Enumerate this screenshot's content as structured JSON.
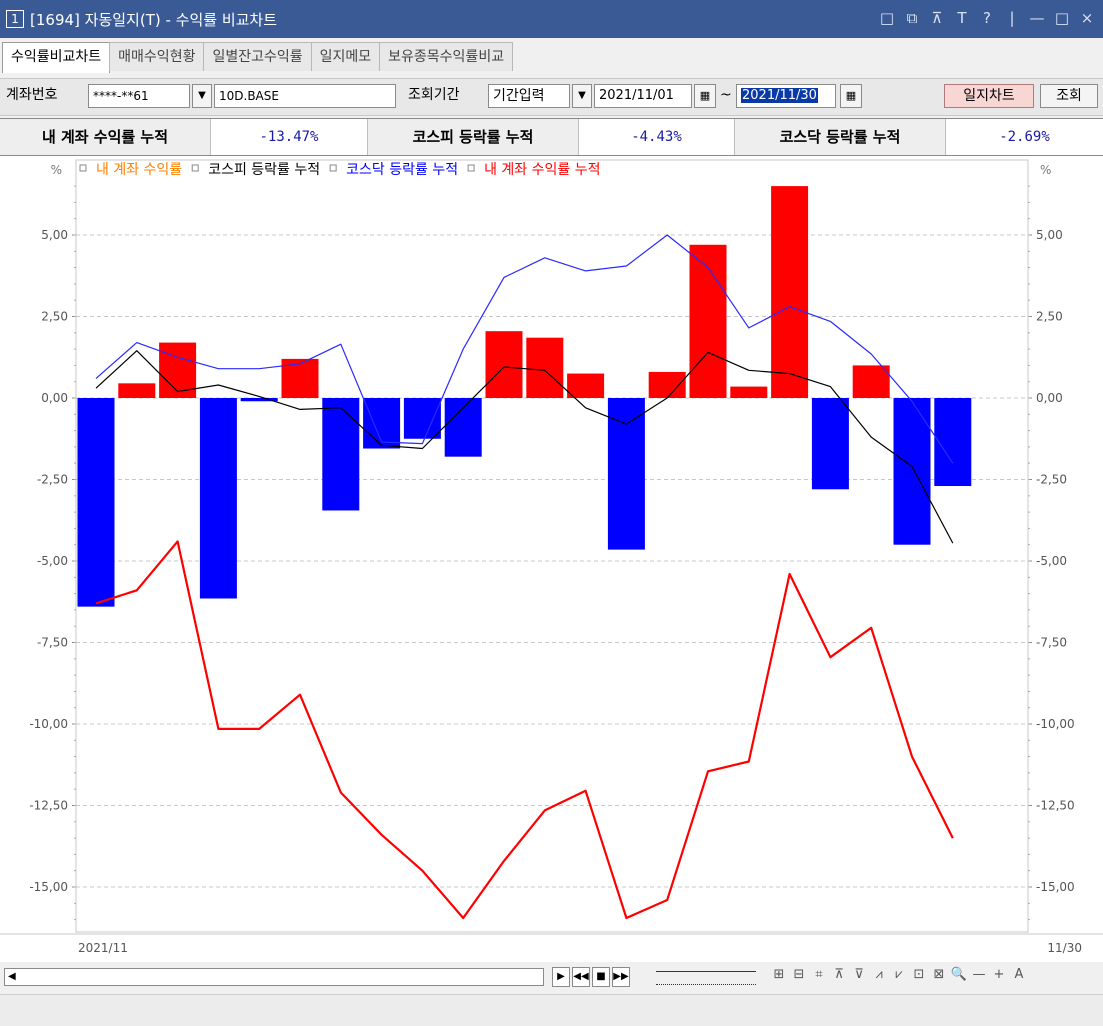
{
  "window": {
    "num": "1",
    "title": "[1694] 자동일지(T) - 수익률 비교차트",
    "controls": [
      "□",
      "⧉",
      "⊼",
      "T",
      "?",
      "|",
      "—",
      "□",
      "×"
    ]
  },
  "tabs": [
    "수익률비교차트",
    "매매수익현황",
    "일별잔고수익률",
    "일지메모",
    "보유종목수익률비교"
  ],
  "toolbar": {
    "account_label": "계좌번호",
    "account_value": "****-**61",
    "account_name": "10D.BASE",
    "period_label": "조회기간",
    "period_mode": "기간입력",
    "date_from": "2021/11/01",
    "tilde": "~",
    "date_to": "2021/11/30",
    "journal_chart_button": "일지차트",
    "search_button": "조회"
  },
  "summary": {
    "my_label": "내 계좌 수익률 누적",
    "my_value": "-13.47%",
    "kospi_label": "코스피 등락률 누적",
    "kospi_value": "-4.43%",
    "kosdaq_label": "코스닥 등락률 누적",
    "kosdaq_value": "-2.69%"
  },
  "colors": {
    "bar_positive": "#ff0000",
    "bar_negative": "#0000ff",
    "kospi_line": "#000000",
    "kosdaq_line": "#2a2aff",
    "my_cum_line": "#ff0000",
    "legend_my_daily": "#ff8000"
  },
  "bottom": {
    "scroll_left": "◀",
    "play_buttons": [
      "▶",
      "◀◀",
      "■",
      "▶▶"
    ],
    "tools": [
      "⊞",
      "⊟",
      "⌗",
      "⊼",
      "⊽",
      "⩘",
      "⩗",
      "⊡",
      "⊠",
      "🔍",
      "—",
      "+",
      "A"
    ]
  },
  "chart_data": {
    "type": "bar",
    "unit_label": "%",
    "x_start_label": "2021/11",
    "x_end_label": "11/30",
    "ylim": [
      -16.5,
      7.0
    ],
    "yticks": [
      "5,00",
      "2,50",
      "0,00",
      "-2,50",
      "-5,00",
      "-7,50",
      "-10,00",
      "-12,50",
      "-15,00"
    ],
    "ytick_values": [
      5,
      2.5,
      0,
      -2.5,
      -5,
      -7.5,
      -10,
      -12.5,
      -15
    ],
    "legend": [
      {
        "label": "내 계좌 수익률",
        "color": "#ff8000"
      },
      {
        "label": "코스피 등락률 누적",
        "color": "#000000"
      },
      {
        "label": "코스닥 등락률 누적",
        "color": "#0000ff"
      },
      {
        "label": "내 계좌 수익률 누적",
        "color": "#ff0000"
      }
    ],
    "series": [
      {
        "name": "내 계좌 수익률",
        "kind": "bar",
        "values": [
          -6.4,
          0.45,
          1.7,
          -6.15,
          -0.1,
          1.2,
          -3.45,
          -1.55,
          -1.25,
          -1.8,
          2.05,
          1.85,
          0.75,
          -4.65,
          0.8,
          4.7,
          0.35,
          6.5,
          -2.8,
          1.0,
          -4.5,
          -2.7
        ]
      },
      {
        "name": "코스피 등락률 누적",
        "kind": "line",
        "values": [
          0.3,
          1.45,
          0.2,
          0.4,
          0.05,
          -0.35,
          -0.3,
          -1.45,
          -1.55,
          -0.3,
          0.95,
          0.85,
          -0.3,
          -0.8,
          0.0,
          1.4,
          0.85,
          0.75,
          0.35,
          -1.2,
          -2.1,
          -4.45
        ]
      },
      {
        "name": "코스닥 등락률 누적",
        "kind": "line",
        "values": [
          0.6,
          1.7,
          1.25,
          0.9,
          0.9,
          1.05,
          1.65,
          -1.35,
          -1.4,
          1.5,
          3.7,
          4.3,
          3.9,
          4.05,
          5.0,
          4.0,
          2.15,
          2.8,
          2.35,
          1.35,
          -0.1,
          -2.0
        ]
      },
      {
        "name": "내 계좌 수익률 누적",
        "kind": "line",
        "values": [
          -6.3,
          -5.9,
          -4.4,
          -10.15,
          -10.15,
          -9.1,
          -12.1,
          -13.4,
          -14.5,
          -15.95,
          -14.2,
          -12.65,
          -12.05,
          -15.95,
          -15.4,
          -11.45,
          -11.15,
          -5.4,
          -7.95,
          -7.05,
          -11.0,
          -13.5
        ]
      }
    ]
  }
}
